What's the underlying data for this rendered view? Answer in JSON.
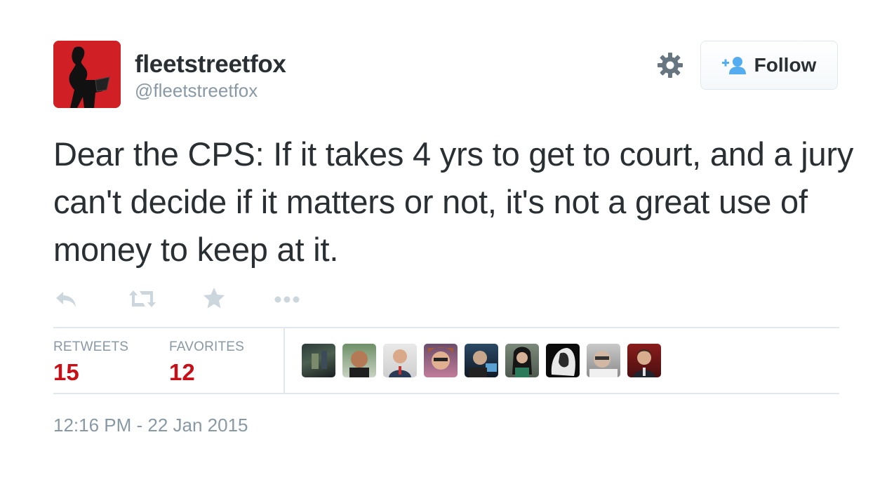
{
  "user": {
    "display_name": "fleetstreetfox",
    "handle": "@fleetstreetfox",
    "avatar": "silhouette-avatar"
  },
  "header": {
    "settings_icon": "gear-icon",
    "follow_label": "Follow",
    "follow_icon": "add-user-icon"
  },
  "tweet": {
    "text": "Dear the CPS: If it takes 4 yrs to get to court, and a jury can't decide if it matters or not, it's not a great use of money to keep at it."
  },
  "actions": [
    {
      "icon": "reply-icon"
    },
    {
      "icon": "retweet-icon"
    },
    {
      "icon": "favorite-star-icon"
    },
    {
      "icon": "more-icon"
    }
  ],
  "stats": {
    "retweets_label": "RETWEETS",
    "retweets_count": "15",
    "favorites_label": "FAVORITES",
    "favorites_count": "12"
  },
  "favorited_by_avatar_count": 9,
  "timestamp": "12:16 PM - 22 Jan 2015",
  "colors": {
    "stat_value": "#c70f18",
    "muted_text": "#8899a6",
    "body_text": "#292f33",
    "avatar_bg": "#d11f26",
    "follow_icon": "#55acee"
  }
}
